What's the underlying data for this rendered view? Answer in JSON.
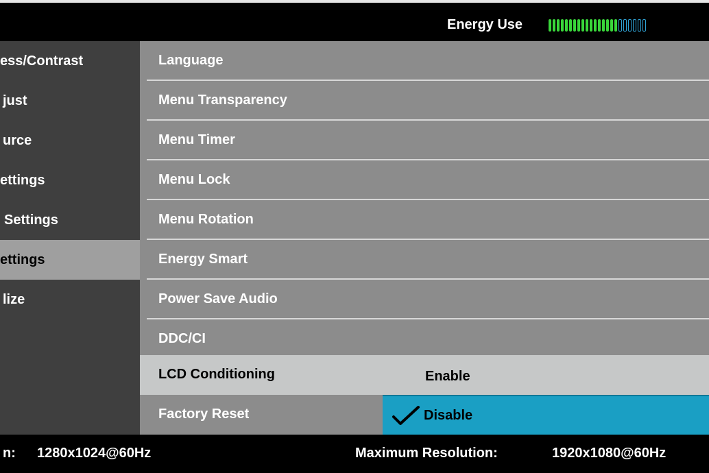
{
  "header": {
    "energy_label": "Energy Use",
    "energy_level": {
      "filled": 17,
      "total": 23
    },
    "colors": {
      "filled": "#39d63a",
      "empty": "#2fa3d6"
    }
  },
  "sidebar": {
    "items": [
      {
        "label": "ess/Contrast"
      },
      {
        "label": "just"
      },
      {
        "label": "urce"
      },
      {
        "label": "ettings"
      },
      {
        "label": "Settings"
      },
      {
        "label": "ettings",
        "active": true
      },
      {
        "label": "lize"
      }
    ]
  },
  "menu": {
    "items": [
      {
        "label": "Language"
      },
      {
        "label": "Menu Transparency"
      },
      {
        "label": "Menu Timer"
      },
      {
        "label": "Menu Lock"
      },
      {
        "label": "Menu Rotation"
      },
      {
        "label": "Energy Smart"
      },
      {
        "label": "Power Save Audio"
      },
      {
        "label": "DDC/CI"
      },
      {
        "label": "LCD Conditioning",
        "highlighted": true
      },
      {
        "label": "Factory Reset"
      }
    ]
  },
  "submenu": {
    "options": [
      {
        "label": "Enable"
      },
      {
        "label": "Disable",
        "selected": true
      }
    ],
    "selected_color": "#1a9fc4"
  },
  "footer": {
    "current_label": "n:",
    "current_value": "1280x1024@60Hz",
    "max_label": "Maximum Resolution:",
    "max_value": "1920x1080@60Hz"
  }
}
